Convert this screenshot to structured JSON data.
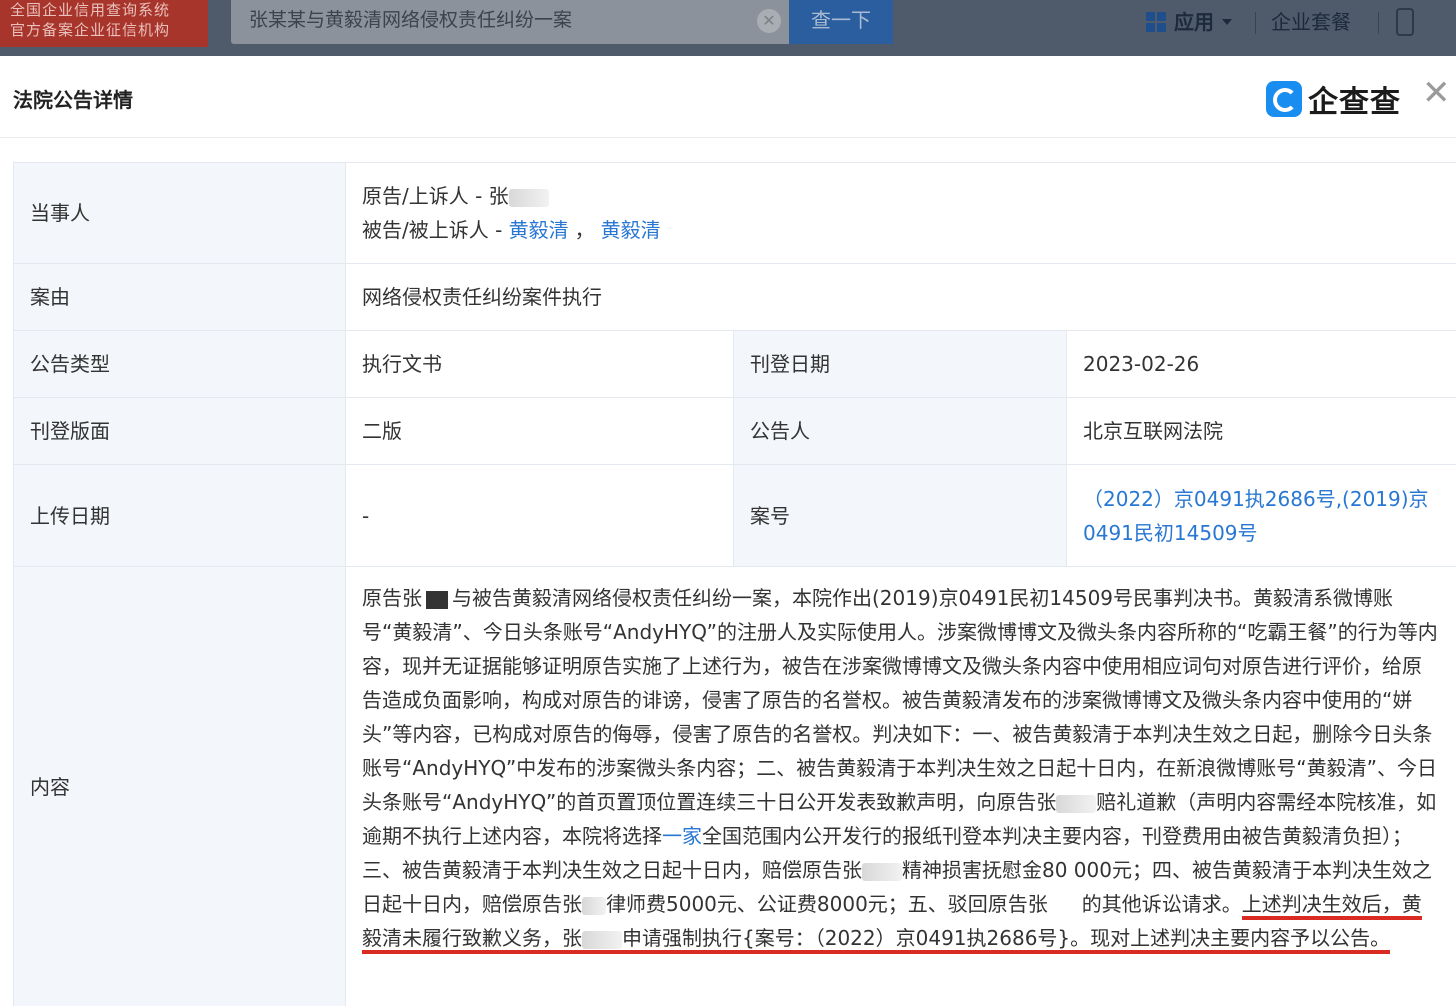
{
  "topbar": {
    "logo_line1": "全国企业信用查询系统",
    "logo_line2": "官方备案企业征信机构",
    "search_value": "张某某与黄毅清网络侵权责任纠纷一案",
    "search_button": "查一下",
    "apps_label": "应用",
    "package_label": "企业套餐"
  },
  "modal": {
    "title": "法院公告详情",
    "brand": "企查查"
  },
  "details": {
    "party_label": "当事人",
    "plaintiff_prefix": "原告/上诉人 - 张",
    "defendant_prefix": "被告/被上诉人 - ",
    "defendant_1": "黄毅清",
    "defendant_sep": "，",
    "defendant_2": "黄毅清",
    "cause_label": "案由",
    "cause_value": "网络侵权责任纠纷案件执行",
    "type_label": "公告类型",
    "type_value": "执行文书",
    "pub_date_label": "刊登日期",
    "pub_date_value": "2023-02-26",
    "page_label": "刊登版面",
    "page_value": "二版",
    "announcer_label": "公告人",
    "announcer_value": "北京互联网法院",
    "upload_label": "上传日期",
    "upload_value": "-",
    "case_no_label": "案号",
    "case_no_value": "（2022）京0491执2686号,(2019)京0491民初14509号",
    "content_label": "内容",
    "content_p1": "原告张",
    "content_p2": "与被告黄毅清网络侵权责任纠纷一案，本院作出(2019)京0491民初14509号民事判决书。黄毅清系微博账号“黄毅清”、今日头条账号“AndyHYQ”的注册人及实际使用人。涉案微博博文及微头条内容所称的“吃霸王餐”的行为等内容，现并无证据能够证明原告实施了上述行为，被告在涉案微博博文及微头条内容中使用相应词句对原告进行评价，给原告造成负面影响，构成对原告的诽谤，侵害了原告的名誉权。被告黄毅清发布的涉案微博博文及微头条内容中使用的“姘头”等内容，已构成对原告的侮辱，侵害了原告的名誉权。判决如下：一、被告黄毅清于本判决生效之日起，删除今日头条账号“AndyHYQ”中发布的涉案微头条内容；二、被告黄毅清于本判决生效之日起十日内，在新浪微博账号“黄毅清”、今日头条账号“AndyHYQ”的首页置顶位置连续三十日公开发表致歉声明，向原告张",
    "content_p3": "赔礼道歉（声明内容需经本院核准，如逾期不执行上述内容，本院将选择",
    "content_link": "一家",
    "content_p4": "全国范围内公开发行的报纸刊登本判决主要内容，刊登费用由被告黄毅清负担）；三、被告黄毅清于本判决生效之日起十日内，赔偿原告张",
    "content_p5": "精神损害抚慰金80 000元；四、被告黄毅清于本判决生效之日起十日内，赔偿原告张",
    "content_p6": "律师费5000元、公证费8000元；五、驳回原告张",
    "content_p7": "的其他诉讼请求。",
    "content_p8": "上述判决生效后，黄毅清未履行致歉义务，张",
    "content_p9": "申请强制执行{案号：（2022）京0491执2686号}。现对上述判决主要内容予以公告。"
  },
  "colors": {
    "link": "#2877d3",
    "label_bg": "#f3f6fa",
    "underline_red": "#d92b21",
    "search_button": "#2b5e9f"
  }
}
